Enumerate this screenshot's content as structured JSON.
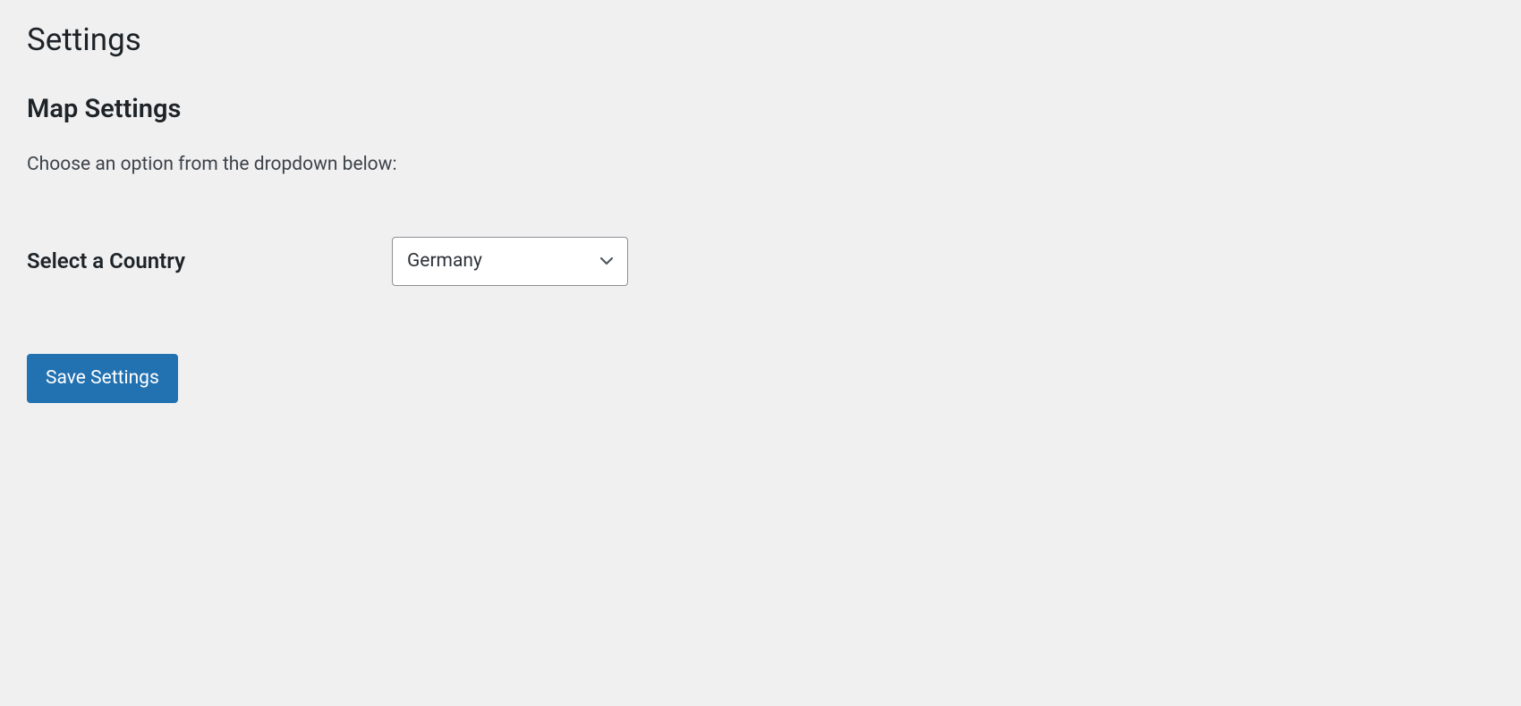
{
  "page": {
    "title": "Settings"
  },
  "section": {
    "title": "Map Settings",
    "description": "Choose an option from the dropdown below:"
  },
  "form": {
    "country_label": "Select a Country",
    "country_selected": "Germany"
  },
  "actions": {
    "save_label": "Save Settings"
  }
}
